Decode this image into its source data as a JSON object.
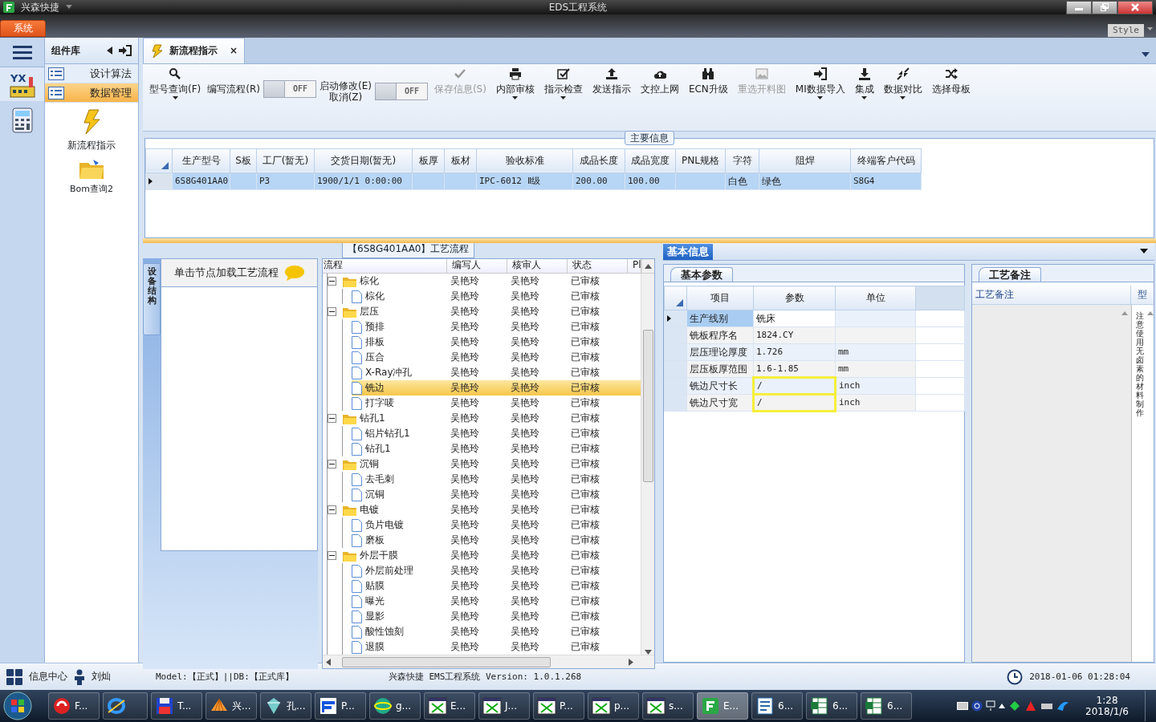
{
  "title_bar": {
    "app_name": "兴森快捷",
    "title": "EDS工程系统"
  },
  "ribbon": {
    "tabs": [
      {
        "label": "系统",
        "selected": true
      }
    ],
    "style_label": "Style"
  },
  "nav_strip": {
    "logo_text": "YX"
  },
  "component_panel": {
    "title": "组件库",
    "items": [
      {
        "label": "设计算法",
        "selected": false
      },
      {
        "label": "数据管理",
        "selected": true
      }
    ],
    "tools": [
      {
        "kind": "flash",
        "label": "新流程指示"
      },
      {
        "kind": "folder",
        "label": "Bom查询2"
      }
    ]
  },
  "document_tab": {
    "label": "新流程指示",
    "close": "×",
    "selected": true
  },
  "toolbar": [
    {
      "kind": "search",
      "lines": [
        "型号查询(F)"
      ],
      "disabled": false,
      "dropdown": true
    },
    {
      "kind": "toggle",
      "lines": [
        "编写流程(R)"
      ],
      "switch_text": "OFF",
      "on": false
    },
    {
      "kind": "toggle",
      "lines": [
        "启动修改(E)",
        "取消(Z)"
      ],
      "switch_text": "OFF",
      "on": false
    },
    {
      "kind": "check",
      "lines": [
        "保存信息(S)"
      ],
      "disabled": true,
      "dropdown": false
    },
    {
      "kind": "print",
      "lines": [
        "内部审核"
      ],
      "disabled": false,
      "dropdown": true
    },
    {
      "kind": "checkbox",
      "lines": [
        "指示检查"
      ],
      "disabled": false,
      "dropdown": true
    },
    {
      "kind": "upload",
      "lines": [
        "发送指示"
      ],
      "disabled": false,
      "dropdown": false
    },
    {
      "kind": "cloud",
      "lines": [
        "文控上网"
      ],
      "disabled": false,
      "dropdown": false
    },
    {
      "kind": "binoculars",
      "lines": [
        "ECN升级"
      ],
      "disabled": false,
      "dropdown": false
    },
    {
      "kind": "image",
      "lines": [
        "重选开料图"
      ],
      "disabled": true,
      "dropdown": false
    },
    {
      "kind": "signin",
      "lines": [
        "MI数据导入"
      ],
      "disabled": false,
      "dropdown": true
    },
    {
      "kind": "download",
      "lines": [
        "集成"
      ],
      "disabled": false,
      "dropdown": true
    },
    {
      "kind": "compress",
      "lines": [
        "数据对比"
      ],
      "disabled": false,
      "dropdown": true
    },
    {
      "kind": "shuffle",
      "lines": [
        "选择母板"
      ],
      "disabled": false,
      "dropdown": false
    }
  ],
  "main_info": {
    "legend": "主要信息",
    "columns": [
      "生产型号",
      "S板",
      "工厂(暂无)",
      "交货日期(暂无)",
      "板厚",
      "板材",
      "验收标准",
      "成品长度",
      "成品宽度",
      "PNL规格",
      "字符",
      "阻焊",
      "终端客户代码"
    ],
    "rows": [
      {
        "selected": true,
        "cells": [
          "6S8G401AA0",
          null,
          "P3",
          "1900/1/1 0:00:00",
          null,
          null,
          "IPC-6012 Ⅱ级",
          "200.00",
          "100.00",
          null,
          "白色",
          "绿色",
          "S8G4"
        ]
      }
    ]
  },
  "process_panel": {
    "side_tab": "设备结构",
    "hint": "单击节点加载工艺流程"
  },
  "process_tree": {
    "title": "【6S8G401AA0】工艺流程",
    "columns": [
      "流程",
      "编写人",
      "核审人",
      "状态",
      "Pl"
    ],
    "nodes": [
      {
        "label": "棕化",
        "author": "吴艳玲",
        "reviewer": "吴艳玲",
        "status": "已审核",
        "expanded": true,
        "selected": false,
        "children": [
          {
            "label": "棕化",
            "author": "吴艳玲",
            "reviewer": "吴艳玲",
            "status": "已审核",
            "selected": false
          }
        ]
      },
      {
        "label": "层压",
        "author": "吴艳玲",
        "reviewer": "吴艳玲",
        "status": "已审核",
        "expanded": true,
        "selected": false,
        "children": [
          {
            "label": "预排",
            "author": "吴艳玲",
            "reviewer": "吴艳玲",
            "status": "已审核",
            "selected": false
          },
          {
            "label": "排板",
            "author": "吴艳玲",
            "reviewer": "吴艳玲",
            "status": "已审核",
            "selected": false
          },
          {
            "label": "压合",
            "author": "吴艳玲",
            "reviewer": "吴艳玲",
            "status": "已审核",
            "selected": false
          },
          {
            "label": "X-Ray冲孔",
            "author": "吴艳玲",
            "reviewer": "吴艳玲",
            "status": "已审核",
            "selected": false
          },
          {
            "label": "铣边",
            "author": "吴艳玲",
            "reviewer": "吴艳玲",
            "status": "已审核",
            "selected": true
          },
          {
            "label": "打字唛",
            "author": "吴艳玲",
            "reviewer": "吴艳玲",
            "status": "已审核",
            "selected": false
          }
        ]
      },
      {
        "label": "钻孔1",
        "author": "吴艳玲",
        "reviewer": "吴艳玲",
        "status": "已审核",
        "expanded": true,
        "selected": false,
        "children": [
          {
            "label": "铝片钻孔1",
            "author": "吴艳玲",
            "reviewer": "吴艳玲",
            "status": "已审核",
            "selected": false
          },
          {
            "label": "钻孔1",
            "author": "吴艳玲",
            "reviewer": "吴艳玲",
            "status": "已审核",
            "selected": false
          }
        ]
      },
      {
        "label": "沉铜",
        "author": "吴艳玲",
        "reviewer": "吴艳玲",
        "status": "已审核",
        "expanded": true,
        "selected": false,
        "children": [
          {
            "label": "去毛刺",
            "author": "吴艳玲",
            "reviewer": "吴艳玲",
            "status": "已审核",
            "selected": false
          },
          {
            "label": "沉铜",
            "author": "吴艳玲",
            "reviewer": "吴艳玲",
            "status": "已审核",
            "selected": false
          }
        ]
      },
      {
        "label": "电镀",
        "author": "吴艳玲",
        "reviewer": "吴艳玲",
        "status": "已审核",
        "expanded": true,
        "selected": false,
        "children": [
          {
            "label": "负片电镀",
            "author": "吴艳玲",
            "reviewer": "吴艳玲",
            "status": "已审核",
            "selected": false
          },
          {
            "label": "磨板",
            "author": "吴艳玲",
            "reviewer": "吴艳玲",
            "status": "已审核",
            "selected": false
          }
        ]
      },
      {
        "label": "外层干膜",
        "author": "吴艳玲",
        "reviewer": "吴艳玲",
        "status": "已审核",
        "expanded": true,
        "selected": false,
        "children": [
          {
            "label": "外层前处理",
            "author": "吴艳玲",
            "reviewer": "吴艳玲",
            "status": "已审核",
            "selected": false
          },
          {
            "label": "贴膜",
            "author": "吴艳玲",
            "reviewer": "吴艳玲",
            "status": "已审核",
            "selected": false
          },
          {
            "label": "曝光",
            "author": "吴艳玲",
            "reviewer": "吴艳玲",
            "status": "已审核",
            "selected": false
          },
          {
            "label": "显影",
            "author": "吴艳玲",
            "reviewer": "吴艳玲",
            "status": "已审核",
            "selected": false
          },
          {
            "label": "酸性蚀刻",
            "author": "吴艳玲",
            "reviewer": "吴艳玲",
            "status": "已审核",
            "selected": false
          },
          {
            "label": "退膜",
            "author": "吴艳玲",
            "reviewer": "吴艳玲",
            "status": "已审核",
            "selected": false
          }
        ]
      }
    ]
  },
  "basic_info": {
    "title": "基本信息",
    "params": {
      "tab": "基本参数",
      "columns": [
        "项目",
        "参数",
        "单位"
      ],
      "rows": [
        {
          "item": "生产线别",
          "value": "铣床",
          "selected": true,
          "highlighted": false
        },
        {
          "item": "铣板程序名",
          "value": "1824.CY",
          "selected": false,
          "highlighted": false
        },
        {
          "item": "层压理论厚度",
          "value": "1.726",
          "unit": "mm",
          "selected": false,
          "highlighted": false
        },
        {
          "item": "层压板厚范围",
          "value": "1.6-1.85",
          "unit": "mm",
          "selected": false,
          "highlighted": false
        },
        {
          "item": "铣边尺寸长",
          "value": "/",
          "unit": "inch",
          "selected": false,
          "highlighted": true
        },
        {
          "item": "铣边尺寸宽",
          "value": "/",
          "unit": "inch",
          "selected": false,
          "highlighted": true
        }
      ]
    },
    "notes": {
      "tab": "工艺备注",
      "columns": [
        "工艺备注",
        "型"
      ],
      "type_text": "注意使用无卤素的材料制作"
    }
  },
  "status_bar": {
    "info_center": "信息中心",
    "user": "刘灿",
    "model": "Model:【正式】||DB:【正式库】",
    "version": "兴森快捷 EMS工程系统 Version: 1.0.1.268",
    "datetime": "2018-01-06 01:28:04"
  },
  "taskbar": {
    "items": [
      {
        "kind": "swirl",
        "label": "F...",
        "active": false
      },
      {
        "kind": "ring",
        "active": false
      },
      {
        "kind": "floppy",
        "label": "T...",
        "active": false
      },
      {
        "kind": "shell",
        "label": "兴...",
        "active": false
      },
      {
        "kind": "crystal",
        "label": "孔...",
        "active": false
      },
      {
        "kind": "bars",
        "label": "P...",
        "active": false
      },
      {
        "kind": "globe",
        "label": "g...",
        "active": false
      },
      {
        "kind": "xwin",
        "label": "E...",
        "active": false
      },
      {
        "kind": "xwin",
        "label": "J...",
        "active": false
      },
      {
        "kind": "xwin",
        "label": "P...",
        "active": false
      },
      {
        "kind": "xwin",
        "label": "p...",
        "active": false
      },
      {
        "kind": "xwin",
        "label": "s...",
        "active": false
      },
      {
        "kind": "square",
        "label": "E...",
        "active": true
      },
      {
        "kind": "document",
        "label": "6...",
        "active": false
      },
      {
        "kind": "sheet",
        "label": "6...",
        "active": false
      },
      {
        "kind": "sheet",
        "label": "6...",
        "active": false
      }
    ],
    "time": "1:28",
    "date": "2018/1/6"
  }
}
